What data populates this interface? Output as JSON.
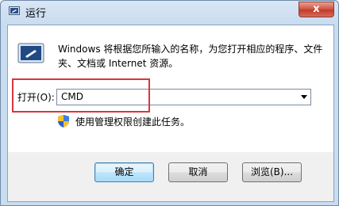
{
  "window": {
    "title": "运行",
    "close_label": "x",
    "icon": "run-icon"
  },
  "dialog": {
    "description": "Windows 将根据您所输入的名称，为您打开相应的程序、文件夹、文档或 Internet 资源。",
    "open_label": "打开(O):",
    "open_value": "CMD",
    "admin_note": "使用管理权限创建此任务。"
  },
  "buttons": {
    "ok": "确定",
    "cancel": "取消",
    "browse": "浏览(B)..."
  },
  "colors": {
    "highlight": "#d8363f",
    "title_bar": "#c9dcf0",
    "close": "#c0392b"
  }
}
